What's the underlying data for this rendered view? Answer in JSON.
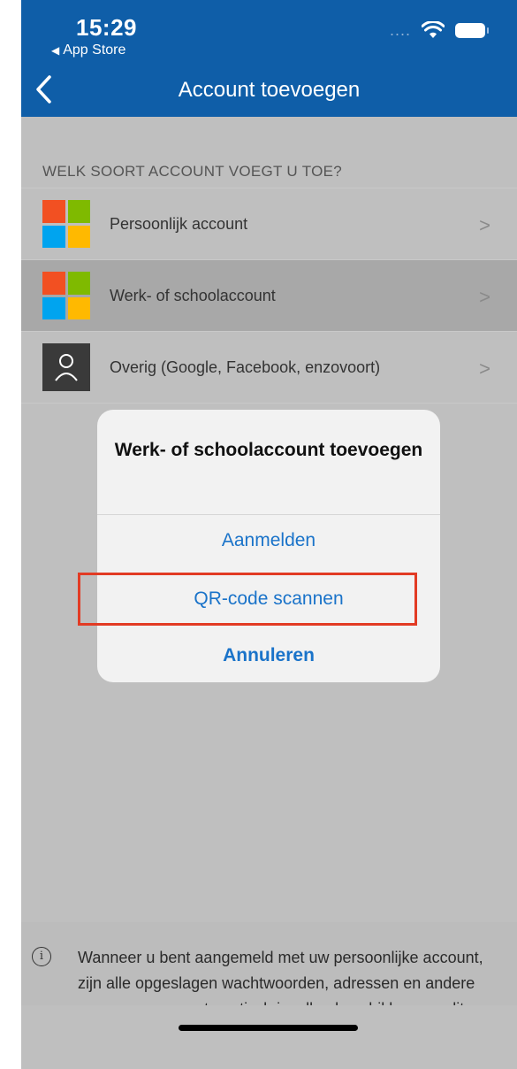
{
  "status_bar": {
    "time": "15:29",
    "back_app": "App Store",
    "signal_dots": "....",
    "icons": [
      "wifi-icon",
      "battery-icon"
    ]
  },
  "nav": {
    "title": "Account toevoegen",
    "back_icon": "chevron-left-icon"
  },
  "section_header": "WELK SOORT ACCOUNT VOEGT U TOE?",
  "accounts": [
    {
      "label": "Persoonlijk account",
      "icon": "microsoft-logo-icon"
    },
    {
      "label": "Werk- of schoolaccount",
      "icon": "microsoft-logo-icon",
      "selected": true
    },
    {
      "label": "Overig (Google, Facebook, enzovoort)",
      "icon": "person-icon"
    }
  ],
  "action_sheet": {
    "title": "Werk- of schoolaccount toevoegen",
    "options": [
      "Aanmelden",
      "QR-code scannen"
    ],
    "cancel": "Annuleren",
    "highlight_color": "#e23b24"
  },
  "footer": {
    "text": "Wanneer u bent aangemeld met uw persoonlijke account, zijn alle opgeslagen wachtwoorden, adressen en andere gegevens voor automatisch invullen beschikbaar op dit apparaat."
  },
  "colors": {
    "nav_bar": "#0f5ea8",
    "link_blue": "#1a73c9",
    "ms_red": "#f25022",
    "ms_green": "#7fba00",
    "ms_blue": "#00a4ef",
    "ms_yellow": "#ffb900"
  }
}
